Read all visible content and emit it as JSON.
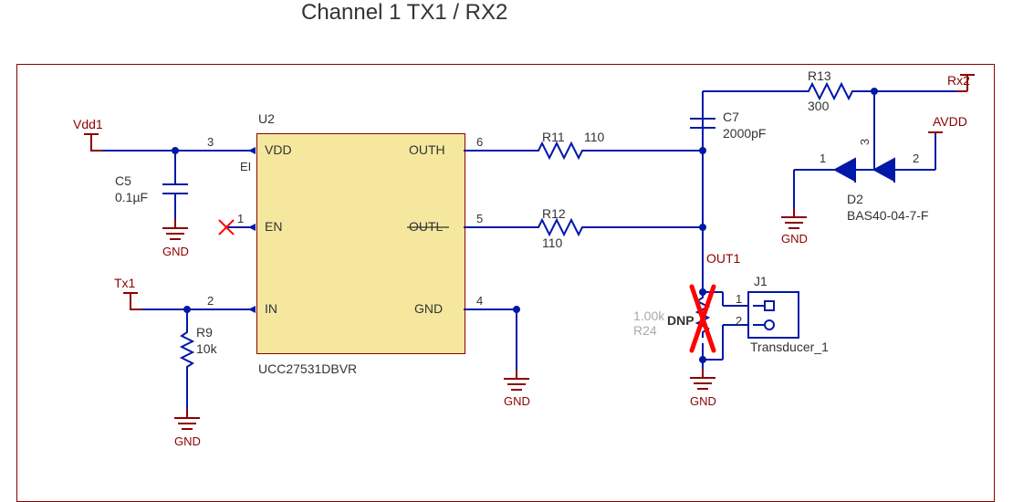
{
  "title": "Channel 1 TX1 / RX2",
  "chip": {
    "refdes": "U2",
    "part": "UCC27531DBVR",
    "pins": {
      "vdd": {
        "num": "3",
        "name": "VDD"
      },
      "en": {
        "num": "1",
        "name": "EN"
      },
      "in": {
        "num": "2",
        "name": "IN"
      },
      "outh": {
        "num": "6",
        "name": "OUTH"
      },
      "outl": {
        "num": "5",
        "name": "OUTL"
      },
      "gnd": {
        "num": "4",
        "name": "GND"
      }
    }
  },
  "components": {
    "C5": {
      "ref": "C5",
      "val": "0.1µF"
    },
    "R9": {
      "ref": "R9",
      "val": "10k"
    },
    "R11": {
      "ref": "R11",
      "val": "110"
    },
    "R12": {
      "ref": "R12",
      "val": "110"
    },
    "R13": {
      "ref": "R13",
      "val": "300"
    },
    "C7": {
      "ref": "C7",
      "val": "2000pF"
    },
    "R24": {
      "ref": "R24",
      "val": "1.00k",
      "dnp": "DNP"
    },
    "D2": {
      "ref": "D2",
      "val": "BAS40-04-7-F",
      "pins": {
        "a": "1",
        "k": "2",
        "c": "3"
      }
    },
    "J1": {
      "ref": "J1",
      "name": "Transducer_1",
      "pins": {
        "p1": "1",
        "p2": "2"
      }
    }
  },
  "nets": {
    "vdd1": "Vdd1",
    "tx1": "Tx1",
    "gnd": "GND",
    "rx2": "Rx2",
    "avdd": "AVDD",
    "out1": "OUT1"
  },
  "misc": {
    "ei": "EI"
  }
}
